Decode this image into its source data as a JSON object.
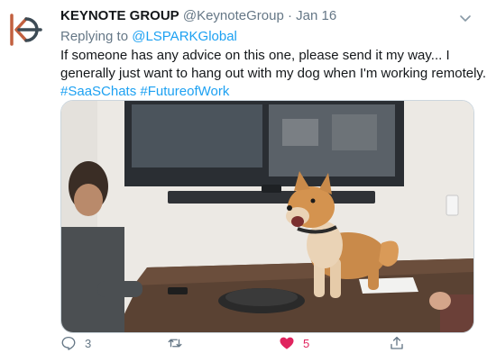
{
  "tweet": {
    "display_name": "KEYNOTE GROUP",
    "handle": "@KeynoteGroup",
    "separator": "·",
    "date": "Jan 16",
    "reply_prefix": "Replying to",
    "reply_to": "@LSPARKGlobal",
    "body_line1": "If someone has any advice on this one, please send it my way... I",
    "body_line2": "generally just want to hang out with my dog when I'm working remotely...",
    "hashtag1": "#SaaSChats",
    "hashtag2": "#FutureofWork",
    "media_description_icon": "photo-dog-on-conference-table"
  },
  "actions": {
    "reply_count": "3",
    "retweet_count": "",
    "like_count": "5",
    "reply_icon": "comment-icon",
    "retweet_icon": "retweet-icon",
    "like_icon": "heart-icon",
    "share_icon": "share-icon"
  },
  "colors": {
    "accent": "#1da1f2",
    "like": "#e0245e",
    "secondary": "#657786",
    "logo": "#c2603f"
  }
}
